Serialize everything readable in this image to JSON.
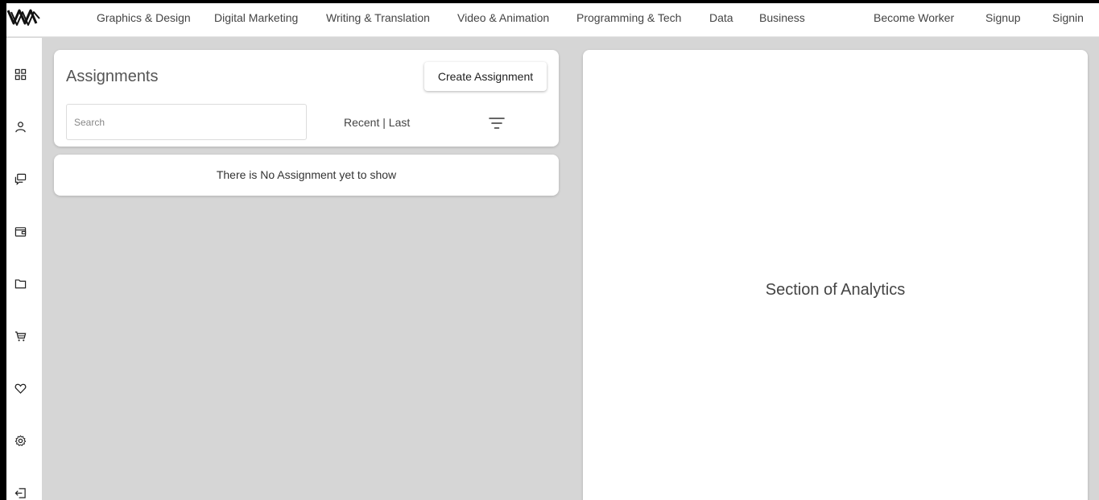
{
  "nav": {
    "logo_icon": "wave-logo",
    "categories": [
      "Graphics & Design",
      "Digital Marketing",
      "Writing & Translation",
      "Video & Animation",
      "Programming & Tech",
      "Data",
      "Business"
    ],
    "become_worker": "Become Worker",
    "signup": "Signup",
    "signin": "Signin"
  },
  "sidebar": {
    "icons": [
      "dashboard-icon",
      "user-icon",
      "chat-icon",
      "wallet-icon",
      "folder-icon",
      "cart-icon",
      "heart-icon",
      "gear-icon",
      "logout-icon"
    ]
  },
  "assignments": {
    "title": "Assignments",
    "create_label": "Create Assignment",
    "search_placeholder": "Search",
    "sort_recent": "Recent",
    "sort_separator": "|",
    "sort_last": "Last",
    "filter_icon": "filter-icon",
    "empty_message": "There is No Assignment yet to show"
  },
  "analytics": {
    "label": "Section of Analytics"
  },
  "colors": {
    "page_background": "#d6d6d6",
    "frame": "#000000",
    "card": "#ffffff"
  }
}
